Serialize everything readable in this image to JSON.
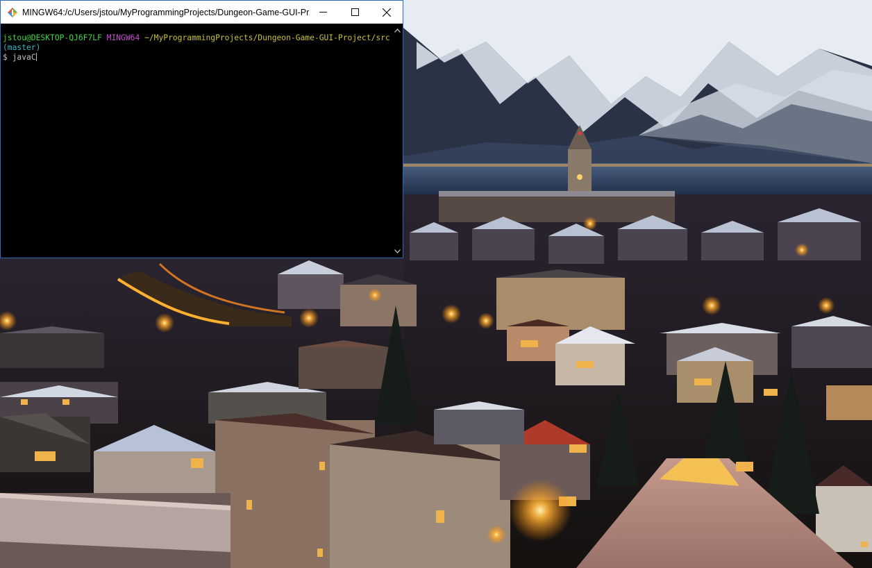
{
  "window": {
    "title": "MINGW64:/c/Users/jstou/MyProgrammingProjects/Dungeon-Game-GUI-Pr...",
    "icon": "git-bash-icon",
    "controls": [
      "minimize-icon",
      "maximize-icon",
      "close-icon"
    ]
  },
  "terminal": {
    "user_host": "jstou@DESKTOP-QJ6F7LF",
    "system": "MINGW64",
    "path": "~/MyProgrammingProjects/Dungeon-Game-GUI-Project/src",
    "branch": "(master)",
    "prompt_symbol": "$",
    "input": "javaC"
  },
  "colors": {
    "user": "#3fd63f",
    "system": "#c64fd0",
    "path": "#c9c23a",
    "branch": "#35b7c8",
    "window_border": "#2b6cb3"
  }
}
